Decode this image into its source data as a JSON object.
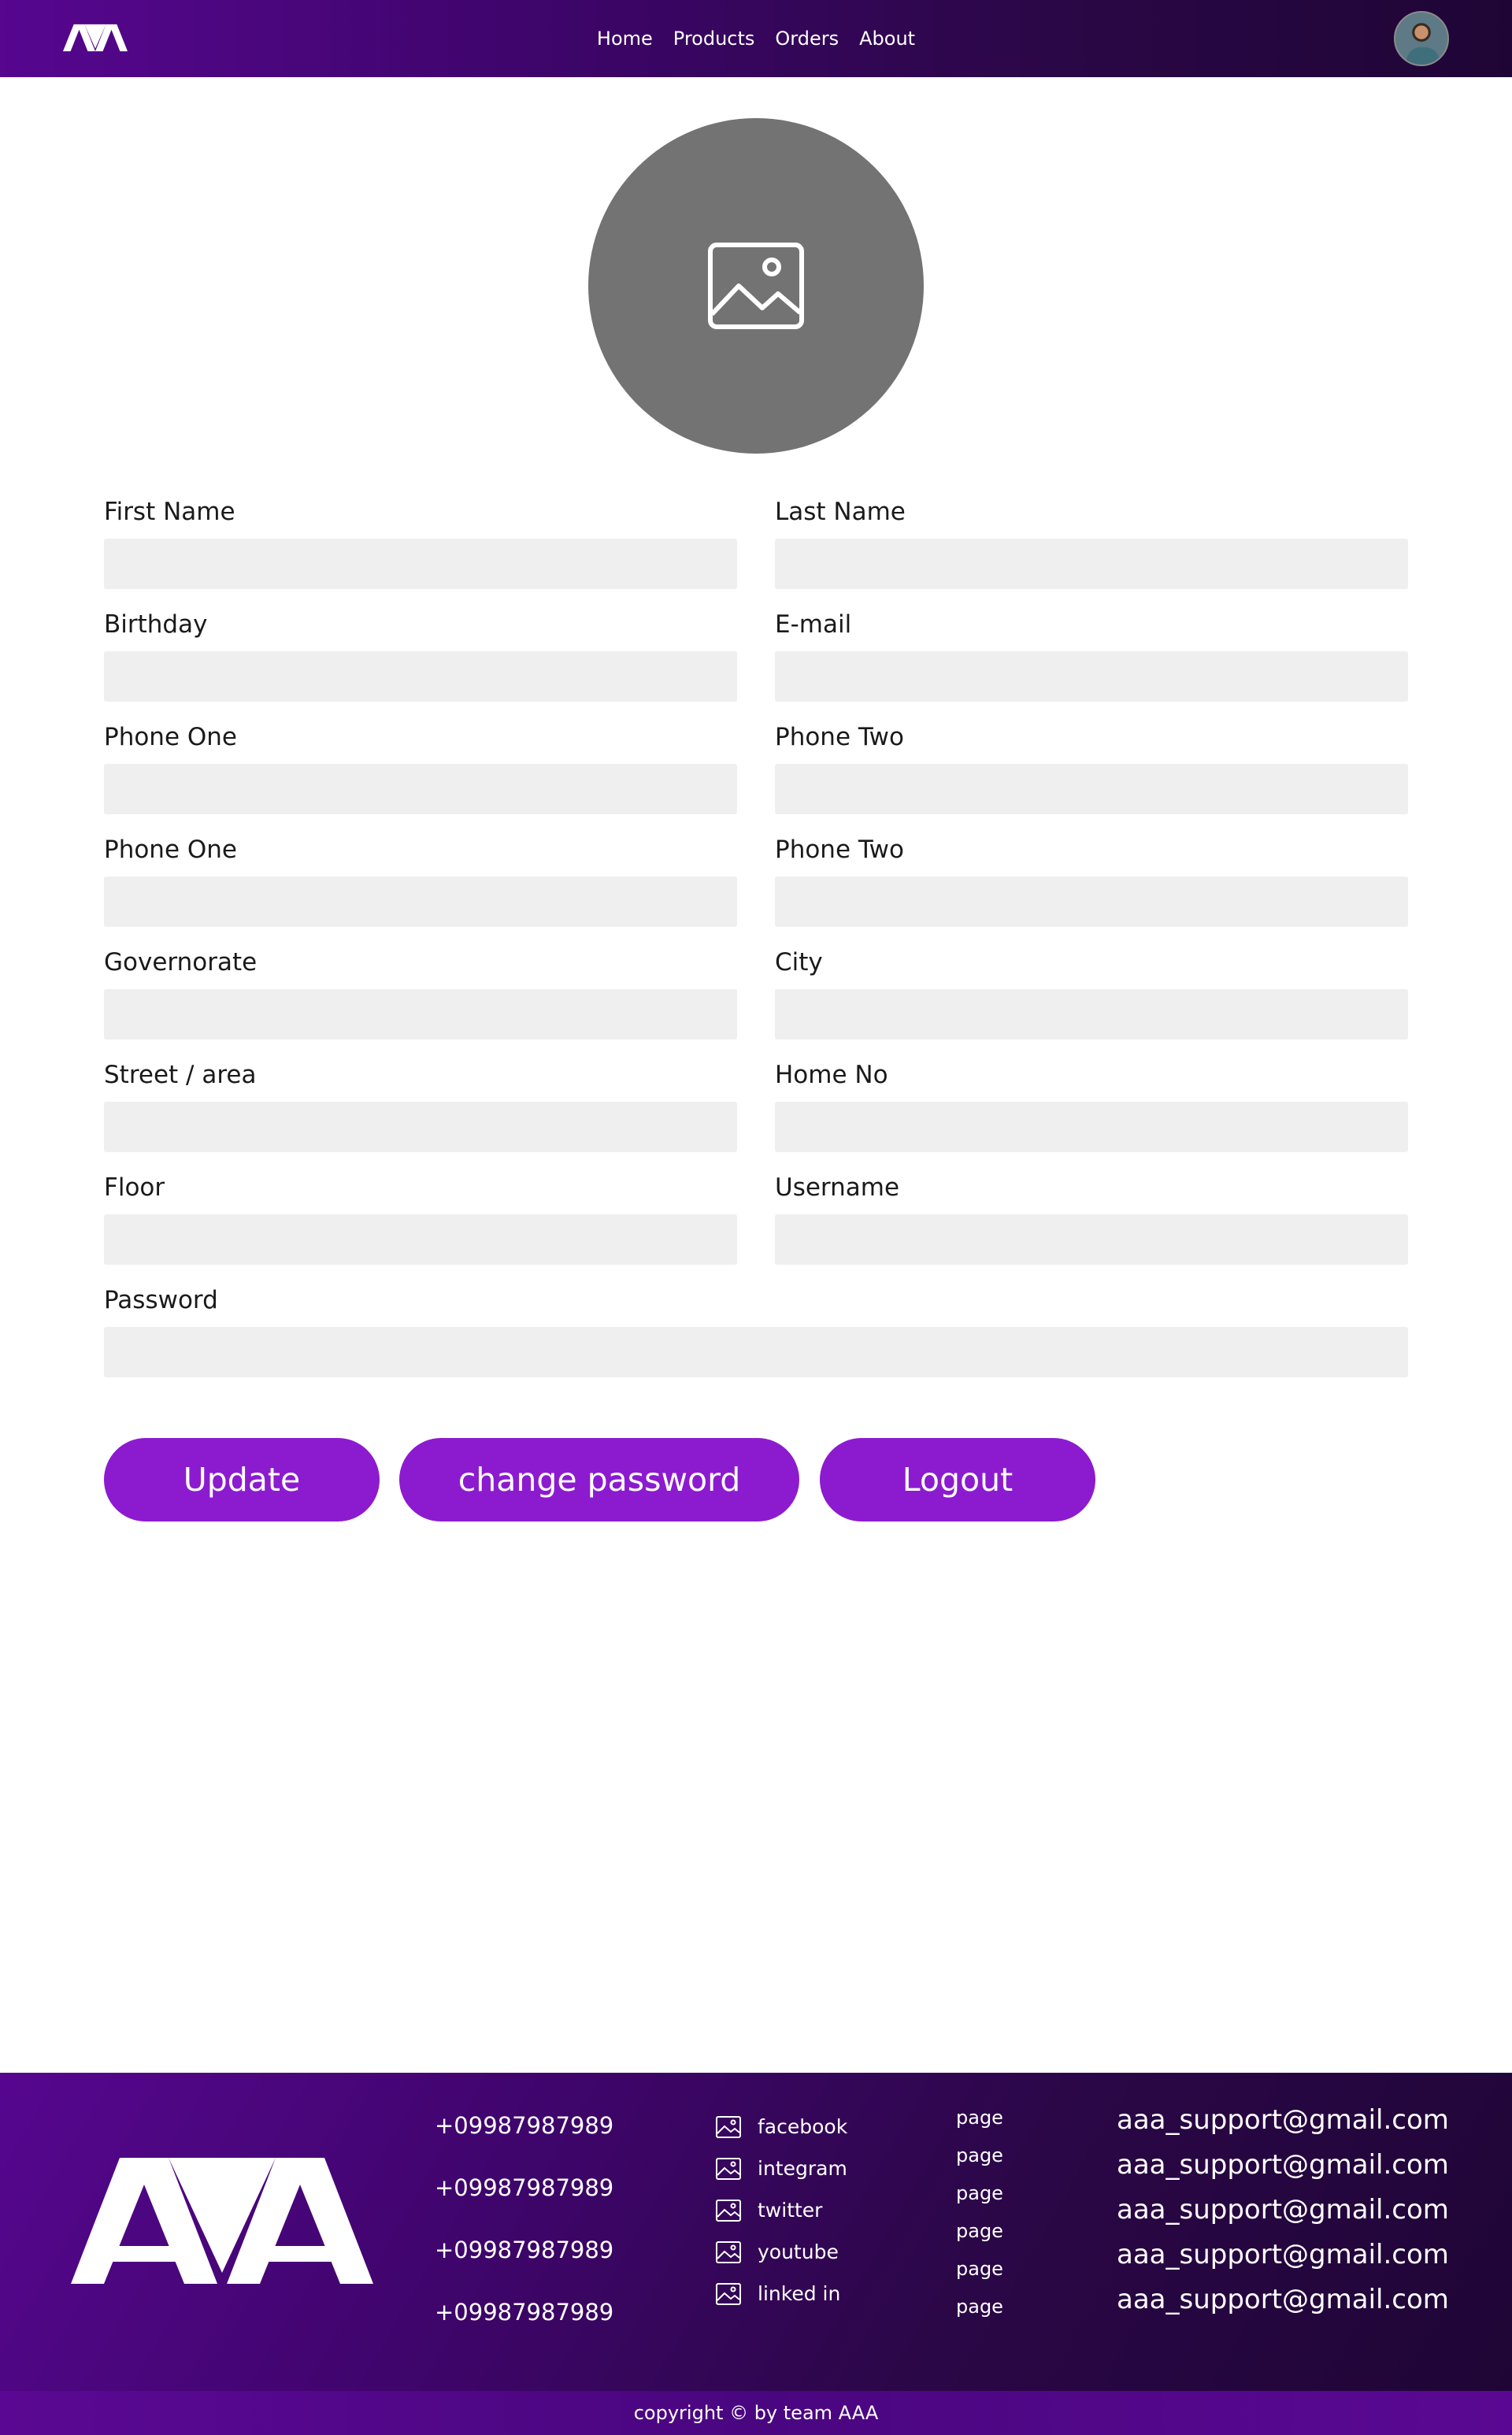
{
  "nav": {
    "links": [
      "Home",
      "Products",
      "Orders",
      "About"
    ]
  },
  "form": {
    "fields": [
      {
        "label": "First Name",
        "value": ""
      },
      {
        "label": "Last Name",
        "value": ""
      },
      {
        "label": "Birthday",
        "value": ""
      },
      {
        "label": "E-mail",
        "value": ""
      },
      {
        "label": "Phone One",
        "value": ""
      },
      {
        "label": "Phone Two",
        "value": ""
      },
      {
        "label": "Phone One",
        "value": ""
      },
      {
        "label": "Phone Two",
        "value": ""
      },
      {
        "label": "Governorate",
        "value": ""
      },
      {
        "label": "City",
        "value": ""
      },
      {
        "label": "Street / area",
        "value": ""
      },
      {
        "label": "Home No",
        "value": ""
      },
      {
        "label": "Floor",
        "value": ""
      },
      {
        "label": "Username",
        "value": ""
      },
      {
        "label": "Password",
        "value": ""
      }
    ]
  },
  "buttons": {
    "update": "Update",
    "change_password": "change password",
    "logout": "Logout"
  },
  "footer": {
    "phones": [
      "+09987987989",
      "+09987987989",
      "+09987987989",
      "+09987987989"
    ],
    "socials": [
      "facebook",
      "integram",
      "twitter",
      "youtube",
      "linked in"
    ],
    "pages": [
      "page",
      "page",
      "page",
      "page",
      "page",
      "page"
    ],
    "emails": [
      "aaa_support@gmail.com",
      "aaa_support@gmail.com",
      "aaa_support@gmail.com",
      "aaa_support@gmail.com",
      "aaa_support@gmail.com"
    ],
    "copyright": "copyright © by team AAA"
  },
  "icons": {
    "nav_logo": "aaa-logo-icon",
    "avatar": "user-avatar",
    "profile_placeholder": "image-placeholder-icon",
    "social_icon": "image-icon",
    "footer_logo": "aaa-logo-icon"
  },
  "colors": {
    "primary": "#8c1bd0",
    "header_dark": "#1f0536",
    "header_light": "#56068f",
    "input_bg": "#efefef",
    "placeholder_circle": "#737373"
  }
}
